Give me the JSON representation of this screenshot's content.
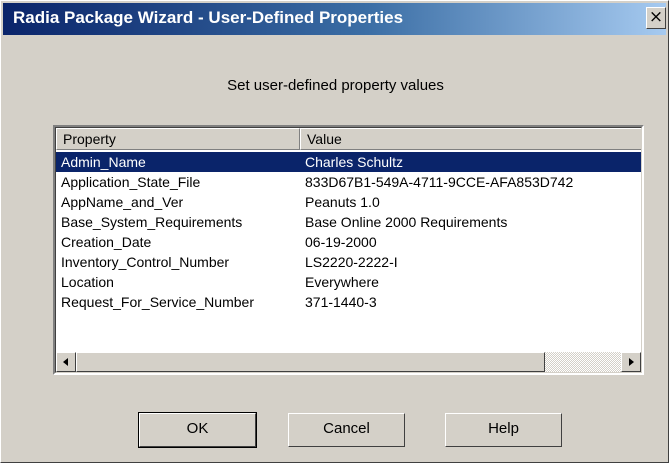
{
  "window": {
    "title": "Radia Package Wizard - User-Defined Properties",
    "close_glyph": "×"
  },
  "dialog": {
    "instruction": "Set user-defined property values"
  },
  "table": {
    "columns": [
      "Property",
      "Value"
    ],
    "selected_row": 0,
    "rows": [
      {
        "property": "Admin_Name",
        "value": "Charles Schultz"
      },
      {
        "property": "Application_State_File",
        "value": "833D67B1-549A-4711-9CCE-AFA853D742"
      },
      {
        "property": "AppName_and_Ver",
        "value": "Peanuts 1.0"
      },
      {
        "property": "Base_System_Requirements",
        "value": "Base Online 2000 Requirements"
      },
      {
        "property": "Creation_Date",
        "value": "06-19-2000"
      },
      {
        "property": "Inventory_Control_Number",
        "value": "LS2220-2222-I"
      },
      {
        "property": "Location",
        "value": "Everywhere"
      },
      {
        "property": "Request_For_Service_Number",
        "value": "371-1440-3"
      }
    ]
  },
  "scrollbar": {
    "position_fraction": 0.0,
    "visible_fraction": 0.86
  },
  "buttons": {
    "ok": "OK",
    "cancel": "Cancel",
    "help": "Help"
  },
  "colors": {
    "dialog_background": "#d4d0c8",
    "selection": "#0a246a",
    "title_gradient_start": "#0a246a",
    "title_gradient_end": "#a6caf0"
  }
}
